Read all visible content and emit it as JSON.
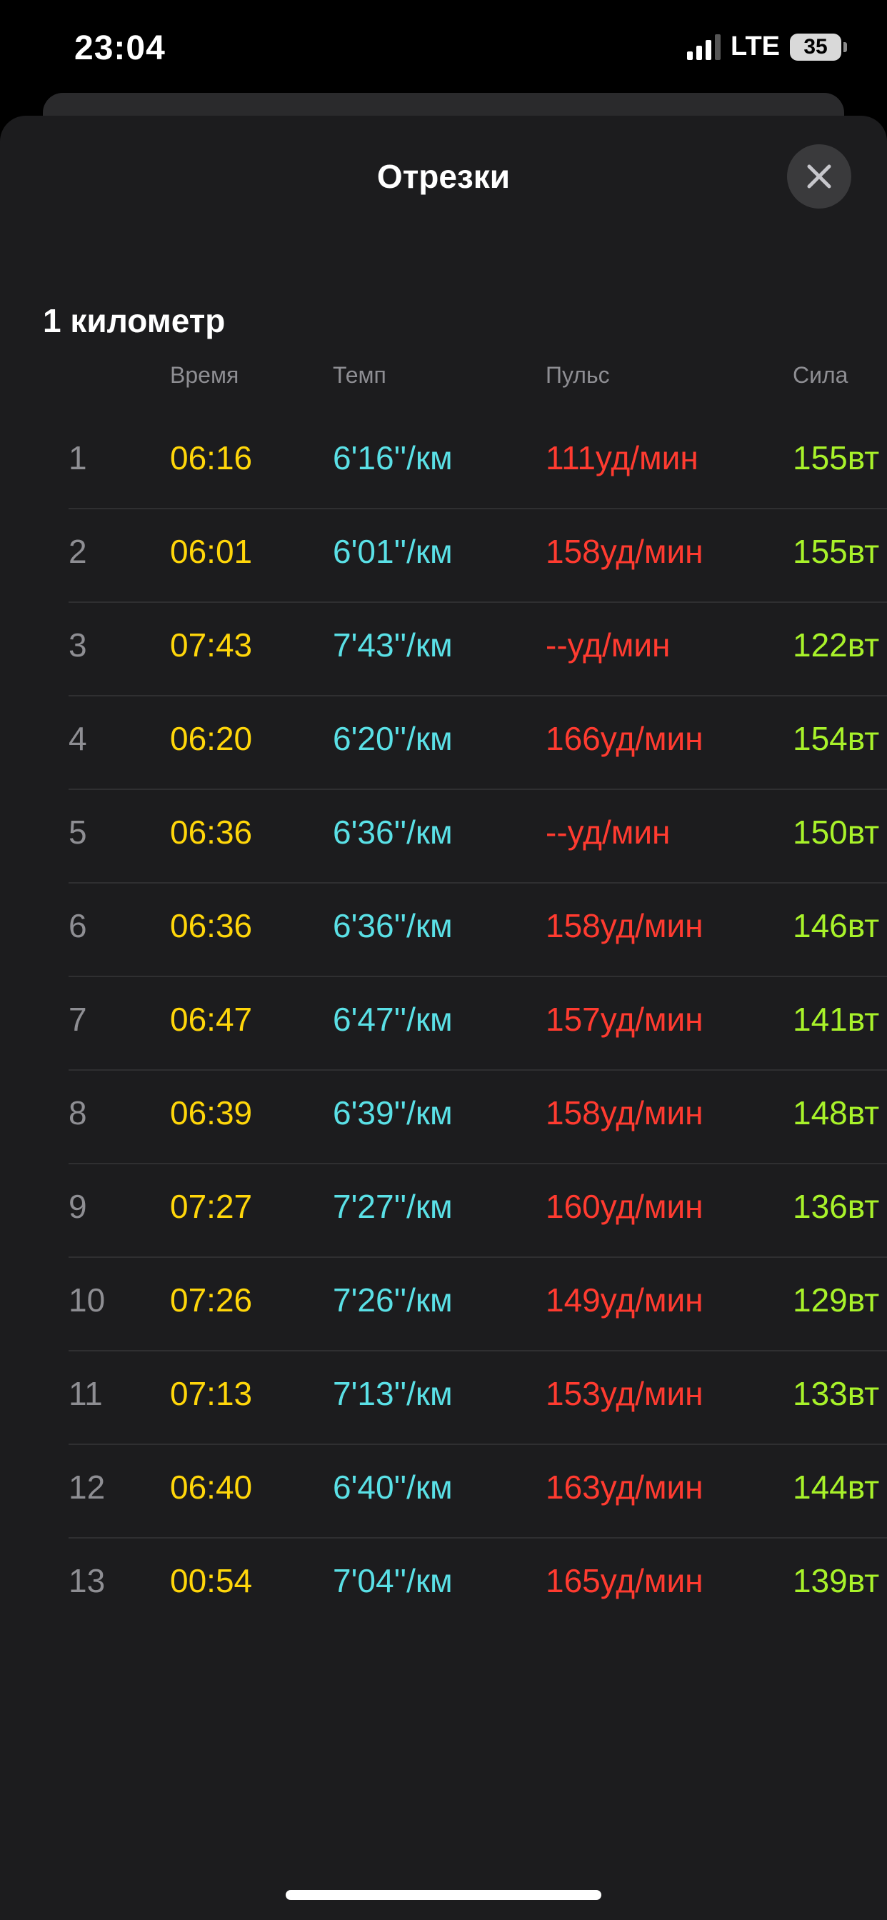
{
  "status_bar": {
    "time": "23:04",
    "network": "LTE",
    "battery": "35"
  },
  "sheet": {
    "title": "Отрезки",
    "close_icon": "close-icon"
  },
  "section": {
    "title": "1 километр",
    "columns": [
      "Время",
      "Темп",
      "Пульс",
      "Сила"
    ]
  },
  "rows": [
    {
      "num": "1",
      "time": "06:16",
      "pace": "6'16''/км",
      "hr": "111уд/мин",
      "power": "155вт"
    },
    {
      "num": "2",
      "time": "06:01",
      "pace": "6'01''/км",
      "hr": "158уд/мин",
      "power": "155вт"
    },
    {
      "num": "3",
      "time": "07:43",
      "pace": "7'43''/км",
      "hr": "--уд/мин",
      "power": "122вт"
    },
    {
      "num": "4",
      "time": "06:20",
      "pace": "6'20''/км",
      "hr": "166уд/мин",
      "power": "154вт"
    },
    {
      "num": "5",
      "time": "06:36",
      "pace": "6'36''/км",
      "hr": "--уд/мин",
      "power": "150вт"
    },
    {
      "num": "6",
      "time": "06:36",
      "pace": "6'36''/км",
      "hr": "158уд/мин",
      "power": "146вт"
    },
    {
      "num": "7",
      "time": "06:47",
      "pace": "6'47''/км",
      "hr": "157уд/мин",
      "power": "141вт"
    },
    {
      "num": "8",
      "time": "06:39",
      "pace": "6'39''/км",
      "hr": "158уд/мин",
      "power": "148вт"
    },
    {
      "num": "9",
      "time": "07:27",
      "pace": "7'27''/км",
      "hr": "160уд/мин",
      "power": "136вт"
    },
    {
      "num": "10",
      "time": "07:26",
      "pace": "7'26''/км",
      "hr": "149уд/мин",
      "power": "129вт"
    },
    {
      "num": "11",
      "time": "07:13",
      "pace": "7'13''/км",
      "hr": "153уд/мин",
      "power": "133вт"
    },
    {
      "num": "12",
      "time": "06:40",
      "pace": "6'40''/км",
      "hr": "163уд/мин",
      "power": "144вт"
    },
    {
      "num": "13",
      "time": "00:54",
      "pace": "7'04''/км",
      "hr": "165уд/мин",
      "power": "139вт"
    }
  ],
  "colors": {
    "time": "#ffd60a",
    "pace": "#5ae0e6",
    "heart_rate": "#ff3b30",
    "power": "#a8f22a",
    "background": "#1c1c1e"
  }
}
